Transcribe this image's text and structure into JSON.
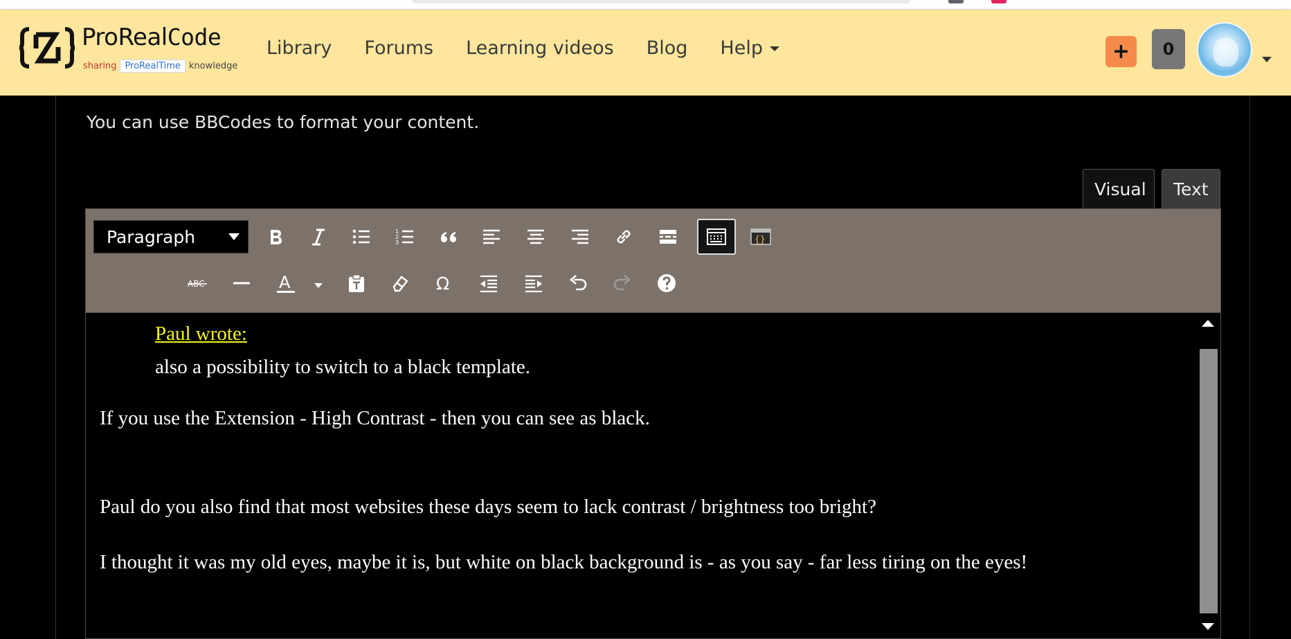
{
  "header": {
    "logo": {
      "name_part1": "ProReal",
      "name_part2": "Code",
      "tagline_left": "sharing",
      "tagline_box": "ProRealTime",
      "tagline_right": "knowledge"
    },
    "nav": [
      {
        "label": "Library"
      },
      {
        "label": "Forums"
      },
      {
        "label": "Learning videos"
      },
      {
        "label": "Blog"
      },
      {
        "label": "Help",
        "has_dropdown": true
      }
    ],
    "add_label": "+",
    "notification_count": "0"
  },
  "colors": {
    "header_bg": "#fee69d",
    "toolbar_bg": "#7d7269",
    "add_button": "#f58a4b",
    "quote_cite": "#f5f517"
  },
  "page": {
    "bbcode_hint": "You can use BBCodes to format your content."
  },
  "editor": {
    "tabs": {
      "visual": "Visual",
      "text": "Text"
    },
    "active_tab": "Visual",
    "format_select": "Paragraph",
    "toolbar_row1_icons": [
      "bold-icon",
      "italic-icon",
      "bullet-list-icon",
      "numbered-list-icon",
      "blockquote-icon",
      "align-left-icon",
      "align-center-icon",
      "align-right-icon",
      "link-icon",
      "read-more-icon",
      "toolbar-toggle-icon",
      "code-icon"
    ],
    "toolbar_row2_icons": [
      "strikethrough-icon",
      "horizontal-line-icon",
      "text-color-icon",
      "paste-text-icon",
      "clear-formatting-icon",
      "special-character-icon",
      "outdent-icon",
      "indent-icon",
      "undo-icon",
      "redo-icon",
      "help-icon"
    ],
    "strikethrough_glyph": "ABC",
    "text_color_glyph": "A",
    "omega_glyph": "Ω",
    "content": {
      "quote_cite": "Paul wrote:",
      "quote_body": "also a possibility to switch to a black template.",
      "paragraphs": [
        "If you use the Extension - High Contrast - then you can see as black.",
        "Paul do you also find that most websites these days seem to lack contrast / brightness too bright?",
        "I thought it was my old eyes, maybe it is, but white on black background is - as you say - far less tiring on the eyes!"
      ]
    }
  }
}
